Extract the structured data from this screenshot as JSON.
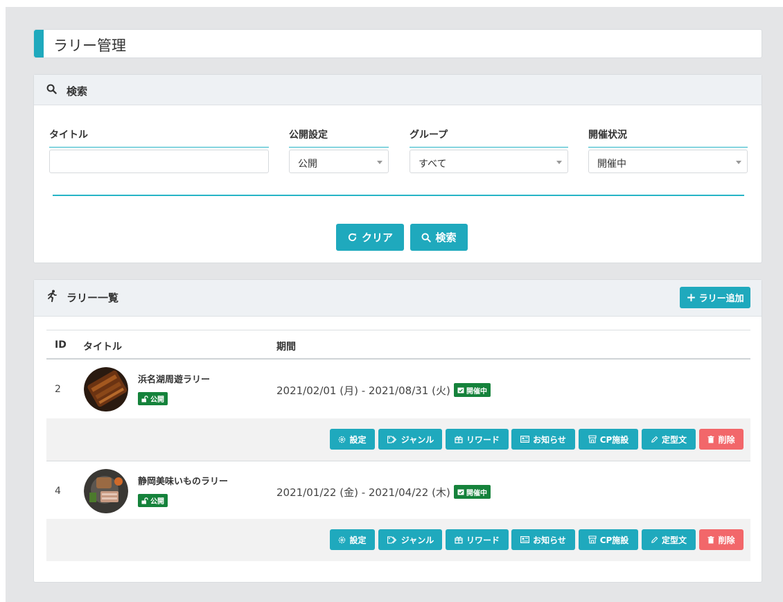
{
  "page": {
    "title": "ラリー管理"
  },
  "search": {
    "header": "検索",
    "fields": {
      "title_label": "タイトル",
      "title_value": "",
      "public_label": "公開設定",
      "public_value": "公開",
      "group_label": "グループ",
      "group_value": "すべて",
      "status_label": "開催状況",
      "status_value": "開催中"
    },
    "clear_label": "クリア",
    "search_label": "検索"
  },
  "rally_list": {
    "header": "ラリー一覧",
    "add_button_label": "ラリー追加",
    "columns": {
      "id": "ID",
      "title": "タイトル",
      "period": "期間"
    },
    "rows": [
      {
        "id": "2",
        "title": "浜名湖周遊ラリー",
        "public_badge": "公開",
        "period": "2021/02/01 (月) - 2021/08/31 (火)",
        "status_badge": "開催中"
      },
      {
        "id": "4",
        "title": "静岡美味いものラリー",
        "public_badge": "公開",
        "period": "2021/01/22 (金) - 2021/04/22 (木)",
        "status_badge": "開催中"
      }
    ],
    "actions": {
      "settings": "設定",
      "genre": "ジャンル",
      "reward": "リワード",
      "notice": "お知らせ",
      "cp_facility": "CP施設",
      "template": "定型文",
      "delete": "削除"
    }
  },
  "colors": {
    "accent": "#1fa9bd",
    "success": "#15823b",
    "danger": "#f2676a"
  }
}
